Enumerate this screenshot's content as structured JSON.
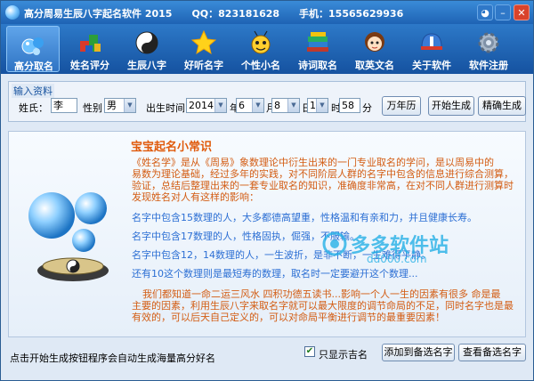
{
  "window": {
    "title": "高分周易生辰八字起名软件 2015　　QQ：823181628　　手机：15565629936"
  },
  "toolbar": {
    "items": [
      {
        "label": "高分取名",
        "icon": "water-droplet-icon"
      },
      {
        "label": "姓名评分",
        "icon": "cubes-icon"
      },
      {
        "label": "生辰八字",
        "icon": "taiji-icon"
      },
      {
        "label": "好听名字",
        "icon": "star-icon"
      },
      {
        "label": "个性小名",
        "icon": "cartoon-bee-icon"
      },
      {
        "label": "诗词取名",
        "icon": "books-icon"
      },
      {
        "label": "取英文名",
        "icon": "girl-avatar-icon"
      },
      {
        "label": "关于软件",
        "icon": "helmet-icon"
      },
      {
        "label": "软件注册",
        "icon": "gear-icon"
      }
    ]
  },
  "form": {
    "legend": "输入资料",
    "surname_label": "姓氏：",
    "surname_value": "李",
    "gender_label": "性别",
    "gender_value": "男",
    "birth_label": "出生时间",
    "year": "2014",
    "year_unit": "年",
    "month": "6",
    "month_unit": "月",
    "day": "8",
    "day_unit": "日",
    "hour": "1",
    "hour_unit": "时",
    "minute": "58",
    "minute_unit": "分",
    "calendar_button": "万年历",
    "start_button": "开始生成",
    "precise_button": "精确生成"
  },
  "content": {
    "heading": "宝宝起名小常识",
    "intro": [
      "《姓名学》是从《周易》象数理论中衍生出来的一门专业取名的学问，是以周易中的",
      "易数为理论基础，经过多年的实践，对不同阶层人群的名字中包含的信息进行综合测算，",
      "验证，总结后整理出来的一套专业取名的知识，准确度非常高，在对不同人群进行测算时",
      "发现姓名对人有这样的影响："
    ],
    "facts": [
      "名字中包含15数理的人，大多都德高望重，性格温和有亲和力，并且健康长寿。",
      "名字中包含17数理的人，性格固执，倔强，不服输。",
      "名字中包含12，14数理的人，一生波折，是非不断，一生难得平静。",
      "还有10这个数理则是最短寿的数理，取名时一定要避开这个数理..."
    ],
    "closing": [
      "我们都知道一命二运三风水 四积功德五读书...影响一个人一生的因素有很多 命是最",
      "主要的因素，利用生辰八字来取名字就可以最大限度的调节命局的不足，同时名字也是最",
      "有效的，可以后天自己定义的，可以对命局平衡进行调节的最重要因素！"
    ]
  },
  "watermark": {
    "text": "多多软件站",
    "url": "dd000.com"
  },
  "footer": {
    "hint": "点击开始生成按钮程序会自动生成海量高分好名",
    "only_show_label": "只显示吉名",
    "only_show_checked": true,
    "add_button": "添加到备选名字",
    "view_button": "查看备选名字"
  },
  "colors": {
    "title_bar": "#1e63b4",
    "heading": "#e05a0b",
    "intro_text": "#d35c12",
    "fact_text": "#2c6fd4"
  }
}
